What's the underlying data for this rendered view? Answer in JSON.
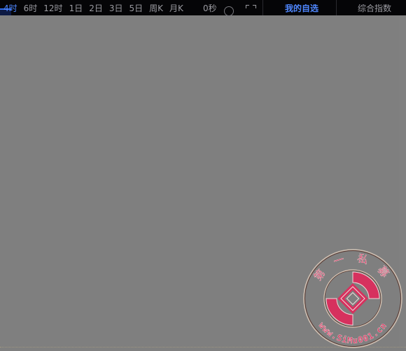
{
  "toolbar": {
    "periods": [
      "4时",
      "6时",
      "12时",
      "1日",
      "2日",
      "3日",
      "5日",
      "周K",
      "月K"
    ],
    "active_period": "4时",
    "countdown": "0秒"
  },
  "tabs": {
    "mine": "我的自选",
    "index": "综合指数"
  },
  "watermark": {
    "top_text": "第 一 私 募",
    "bottom_text": "www.SiMu001.cn"
  },
  "colors": {
    "background": "#7f7f7f",
    "topbar": "#050507",
    "accent": "#4f87ff",
    "seal": "#d6315e"
  }
}
